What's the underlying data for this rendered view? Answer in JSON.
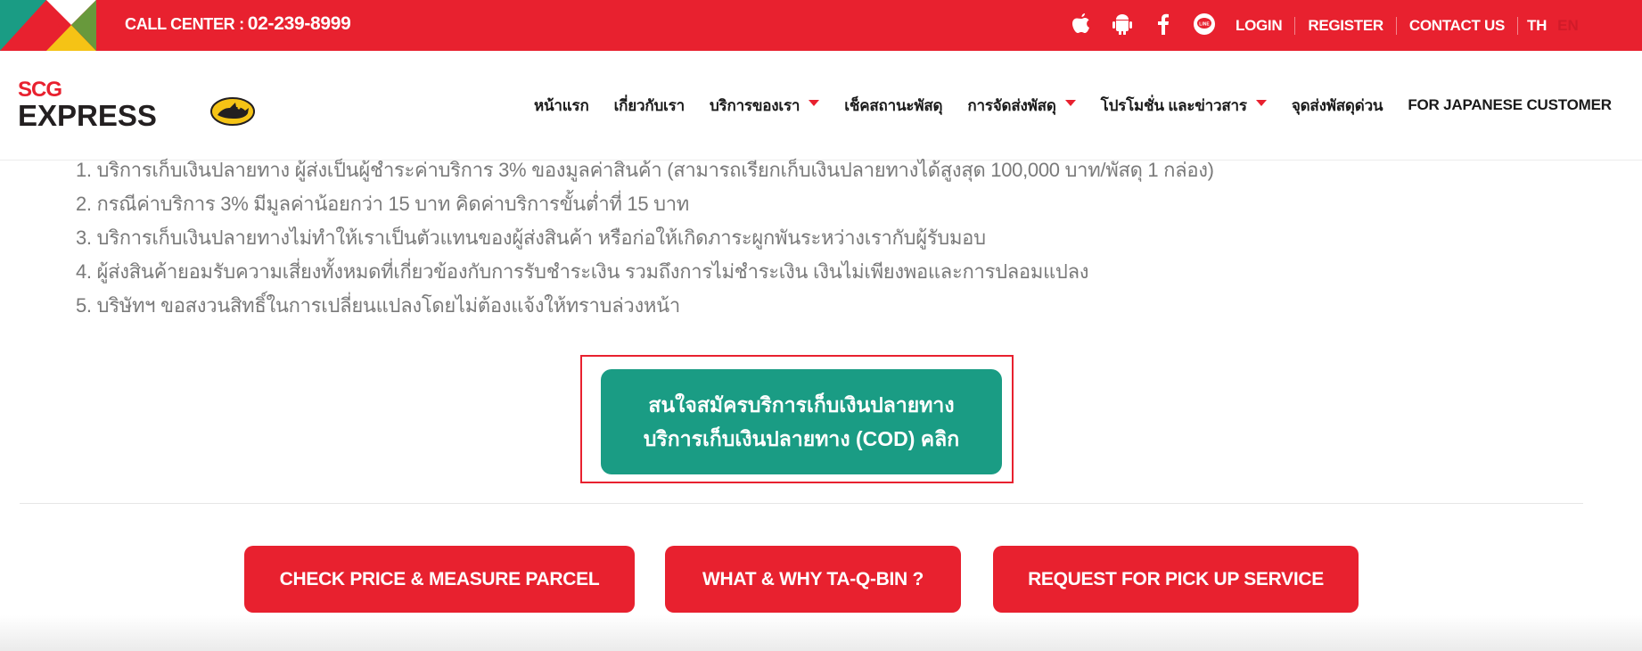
{
  "topbar": {
    "call_center_label": "CALL CENTER :",
    "call_center_number": "02-239-8999",
    "icons": [
      "apple-icon",
      "android-icon",
      "facebook-icon",
      "line-icon"
    ],
    "links": {
      "login": "LOGIN",
      "register": "REGISTER",
      "contact": "CONTACT US"
    },
    "languages": {
      "th": "TH",
      "en": "EN"
    }
  },
  "logo": {
    "line1": "SCG",
    "line2": "EXPRESS"
  },
  "nav": {
    "items": [
      {
        "label": "หน้าแรก"
      },
      {
        "label": "เกี่ยวกับเรา"
      },
      {
        "label": "บริการของเรา"
      },
      {
        "label": "เช็คสถานะพัสดุ"
      },
      {
        "label": "การจัดส่งพัสดุ"
      },
      {
        "label": "โปรโมชั่น และข่าวสาร"
      },
      {
        "label": "จุดส่งพัสดุด่วน"
      },
      {
        "label": "FOR JAPANESE CUSTOMER"
      }
    ]
  },
  "terms": [
    "1. บริการเก็บเงินปลายทาง ผู้ส่งเป็นผู้ชำระค่าบริการ 3% ของมูลค่าสินค้า (สามารถเรียกเก็บเงินปลายทางได้สูงสุด 100,000 บาท/พัสดุ 1 กล่อง)",
    "2. กรณีค่าบริการ 3% มีมูลค่าน้อยกว่า 15 บาท คิดค่าบริการขั้นต่ำที่ 15 บาท",
    "3. บริการเก็บเงินปลายทางไม่ทำให้เราเป็นตัวแทนของผู้ส่งสินค้า หรือก่อให้เกิดภาระผูกพันระหว่างเรากับผู้รับมอบ",
    "4. ผู้ส่งสินค้ายอมรับความเสี่ยงทั้งหมดที่เกี่ยวข้องกับการรับชำระเงิน รวมถึงการไม่ชำระเงิน เงินไม่เพียงพอและการปลอมแปลง",
    "5. บริษัทฯ ขอสงวนสิทธิ์ในการเปลี่ยนแปลงโดยไม่ต้องแจ้งให้ทราบล่วงหน้า"
  ],
  "cod_button": {
    "line1": "สนใจสมัครบริการเก็บเงินปลายทาง",
    "line2": "บริการเก็บเงินปลายทาง (COD) คลิก"
  },
  "cta": {
    "check_price": "CHECK PRICE & MEASURE PARCEL",
    "what_why": "WHAT & WHY TA-Q-BIN ?",
    "pickup": "REQUEST FOR PICK UP SERVICE"
  },
  "colors": {
    "brand_red": "#e8212f",
    "cod_green": "#1a9c84",
    "text_gray": "#7a7a7a"
  }
}
